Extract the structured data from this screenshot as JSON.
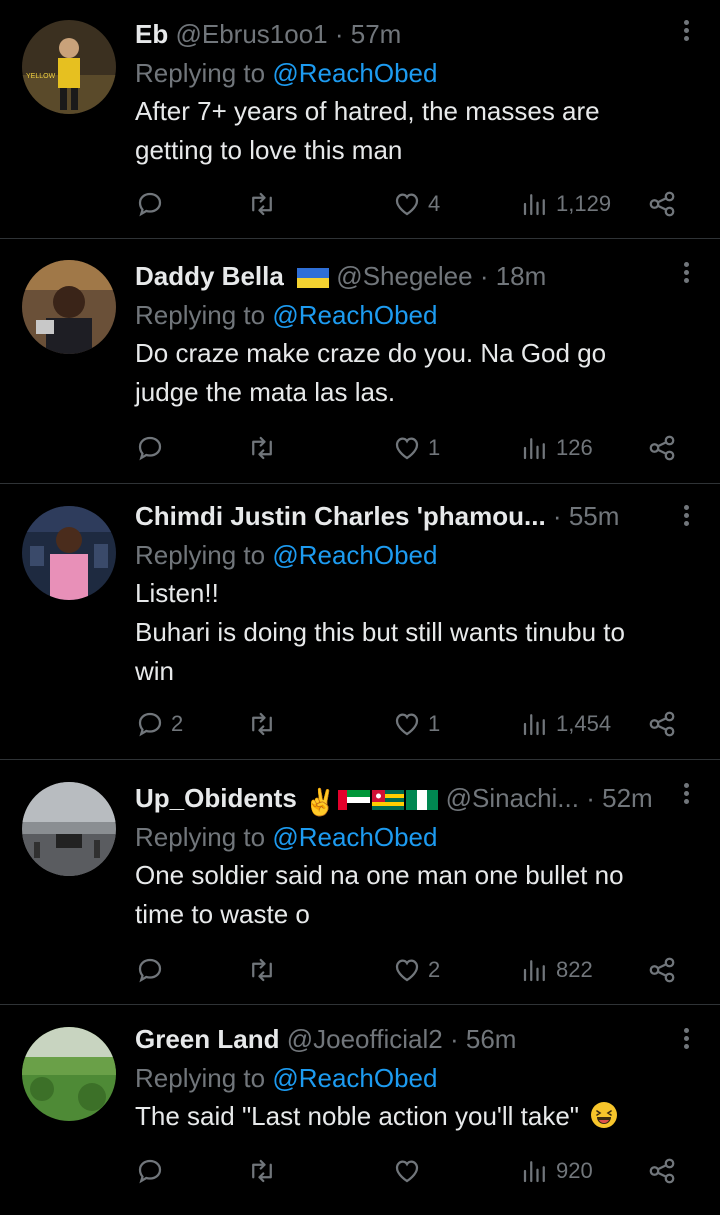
{
  "tweets": [
    {
      "name": "Eb",
      "handle": "@Ebrus1oo1",
      "time": "57m",
      "replying_prefix": "Replying to",
      "mention": "@ReachObed",
      "lines": [
        "After 7+ years of hatred, the masses are",
        "getting to love this man"
      ],
      "replies": "",
      "likes": "4",
      "views": "1,129"
    },
    {
      "name": "Daddy Bella",
      "handle": "@Shegelee",
      "time": "18m",
      "replying_prefix": "Replying to",
      "mention": "@ReachObed",
      "lines": [
        "Do craze make craze do you. Na God go",
        "judge the mata las las."
      ],
      "replies": "",
      "likes": "1",
      "views": "126"
    },
    {
      "name": "Chimdi Justin Charles 'phamou...",
      "handle": "",
      "time": "55m",
      "replying_prefix": "Replying to",
      "mention": "@ReachObed",
      "lines": [
        "Listen!!",
        "Buhari is doing this but still wants tinubu to",
        "win"
      ],
      "replies": "2",
      "likes": "1",
      "views": "1,454"
    },
    {
      "name": "Up_Obidents",
      "handle": "@Sinachi...",
      "time": "52m",
      "replying_prefix": "Replying to",
      "mention": "@ReachObed",
      "lines": [
        "One soldier said na one man one bullet no",
        "time to waste o"
      ],
      "replies": "",
      "likes": "2",
      "views": "822"
    },
    {
      "name": "Green Land",
      "handle": "@Joeofficial2",
      "time": "56m",
      "replying_prefix": "Replying to",
      "mention": "@ReachObed",
      "lines": [
        "The said \"Last noble action you'll take\""
      ],
      "replies": "",
      "likes": "",
      "views": "920"
    }
  ],
  "colors": {
    "background": "#000000",
    "text": "#e7e9ea",
    "muted": "#71767b",
    "link": "#1d9bf0",
    "divider": "#2f3336"
  }
}
